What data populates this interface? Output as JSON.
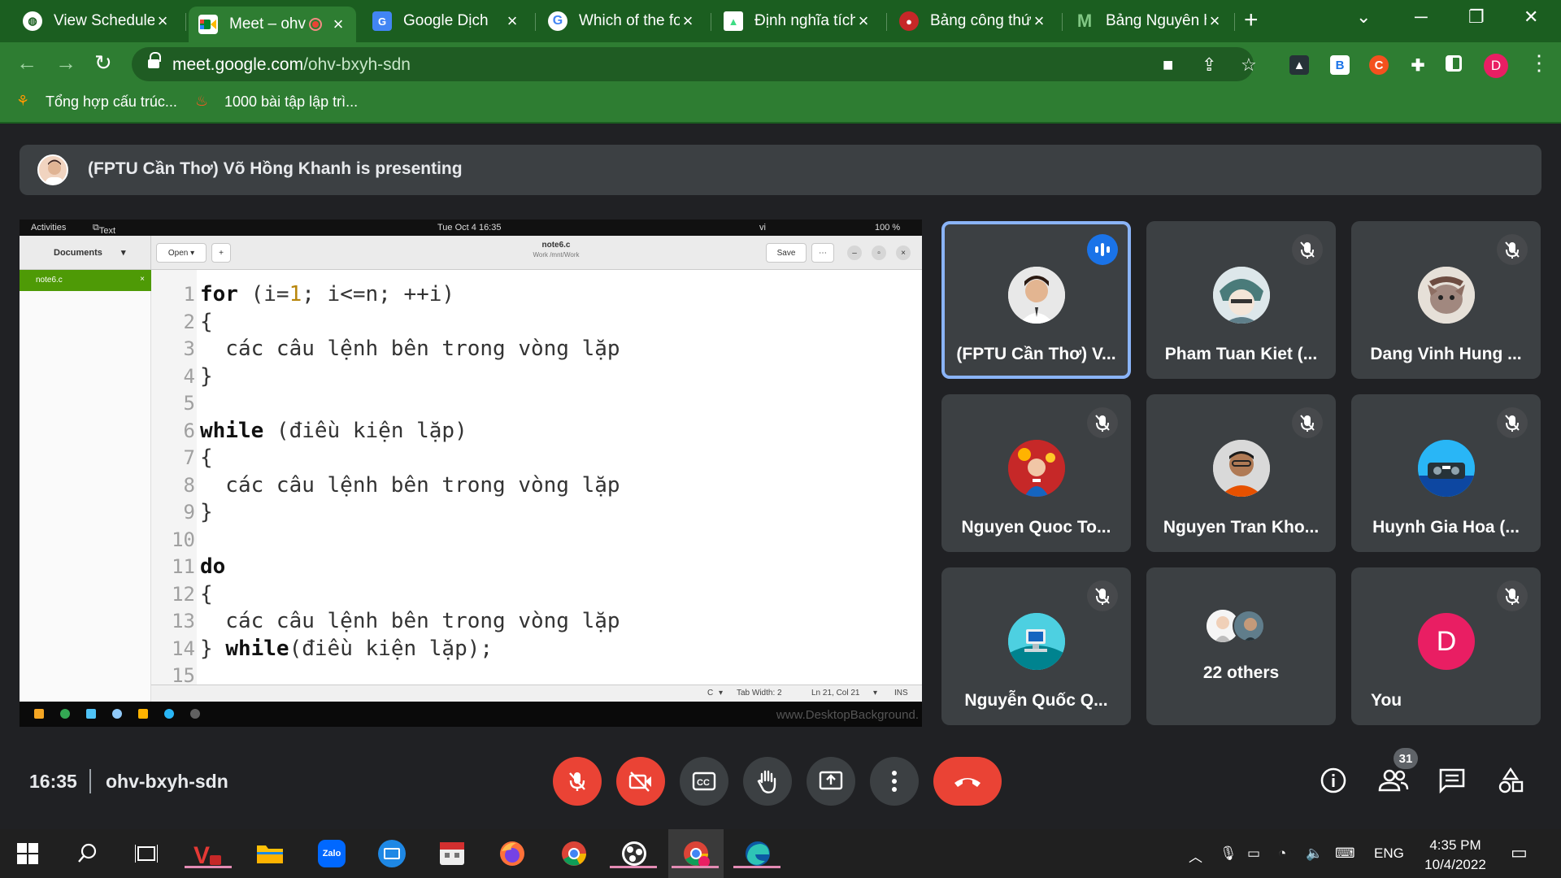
{
  "browser": {
    "tabs": [
      {
        "label": "View Schedule",
        "icon": "globe-icon"
      },
      {
        "label": "Meet – ohv",
        "icon": "meet-icon"
      },
      {
        "label": "Google Dịch",
        "icon": "google-translate-icon"
      },
      {
        "label": "Which of the fo",
        "icon": "google-icon"
      },
      {
        "label": "Định nghĩa tích",
        "icon": "android-icon"
      },
      {
        "label": "Bảng công thứ",
        "icon": "bookmark-icon"
      },
      {
        "label": "Bảng Nguyên h",
        "icon": "m-logo-icon"
      }
    ],
    "url_host": "meet.google.com",
    "url_path": "/ohv-bxyh-sdn",
    "bookmarks": [
      {
        "label": "Tổng hợp cấu trúc...",
        "icon": "cat-icon"
      },
      {
        "label": "1000 bài tập lập trì...",
        "icon": "fire-icon"
      }
    ],
    "profile_initial": "D",
    "ext_b": "B",
    "ext_c": "C"
  },
  "meet": {
    "presenter_banner": "(FPTU Cần Thơ) Võ Hồng Khanh is presenting",
    "meeting_code": "ohv-bxyh-sdn",
    "time": "16:35",
    "participant_count": "31",
    "others_label": "22 others",
    "tiles": [
      {
        "name": "(FPTU Cần Thơ) V...",
        "speaking": true
      },
      {
        "name": "Pham Tuan Kiet (...",
        "speaking": false
      },
      {
        "name": "Dang Vinh Hung ...",
        "speaking": false
      },
      {
        "name": "Nguyen Quoc To...",
        "speaking": false
      },
      {
        "name": "Nguyen Tran Kho...",
        "speaking": false
      },
      {
        "name": "Huynh Gia Hoa (...",
        "speaking": false
      },
      {
        "name": "Nguyễn Quốc Q...",
        "speaking": false
      },
      {
        "name": "You",
        "initial": "D",
        "speaking": false
      }
    ]
  },
  "presentation": {
    "topbar": {
      "activities": "Activities",
      "app": "Text Editor",
      "clock": "Tue Oct 4  16:35",
      "lang": "vi",
      "battery": "100 %"
    },
    "documents_label": "Documents",
    "open_label": "Open",
    "save_label": "Save",
    "file_name": "note6.c",
    "file_path": "Work /mnt/Work",
    "sidebar_doc": "note6.c",
    "status": {
      "lang": "C",
      "tab_width": "Tab Width: 2",
      "position": "Ln 21, Col 21",
      "mode": "INS"
    },
    "watermark": "www.DesktopBackground.",
    "lines": [
      "for (i=1; i<=n; ++i)",
      "{",
      "  các câu lệnh bên trong vòng lặp",
      "}",
      "",
      "while (điều kiện lặp)",
      "{",
      "  các câu lệnh bên trong vòng lặp",
      "}",
      "",
      "do",
      "{",
      "  các câu lệnh bên trong vòng lặp",
      "} while(điều kiện lặp);",
      ""
    ]
  },
  "taskbar": {
    "lang": "ENG",
    "time": "4:35 PM",
    "date": "10/4/2022"
  },
  "colors": {
    "chrome_dark": "#1b5e20",
    "chrome": "#2e7d32",
    "meet_bg": "#202124",
    "tile_bg": "#3c4043",
    "danger": "#ea4335",
    "speaking": "#1a73e8"
  }
}
